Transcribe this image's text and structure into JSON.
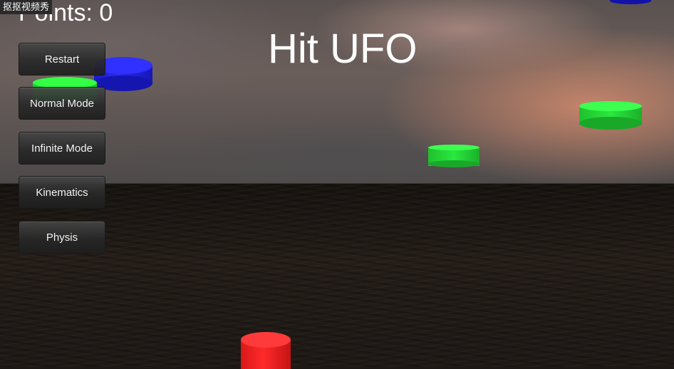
{
  "watermark": "抠抠视频秀",
  "hud": {
    "points_label": "Points: 0",
    "title": "Hit UFO"
  },
  "menu": {
    "buttons": [
      "Restart",
      "Normal Mode",
      "Infinite Mode",
      "Kinematics",
      "Physis"
    ]
  },
  "ufo_colors": {
    "green": "#22e838",
    "blue": "#1d1ee0",
    "red": "#ff2020"
  }
}
